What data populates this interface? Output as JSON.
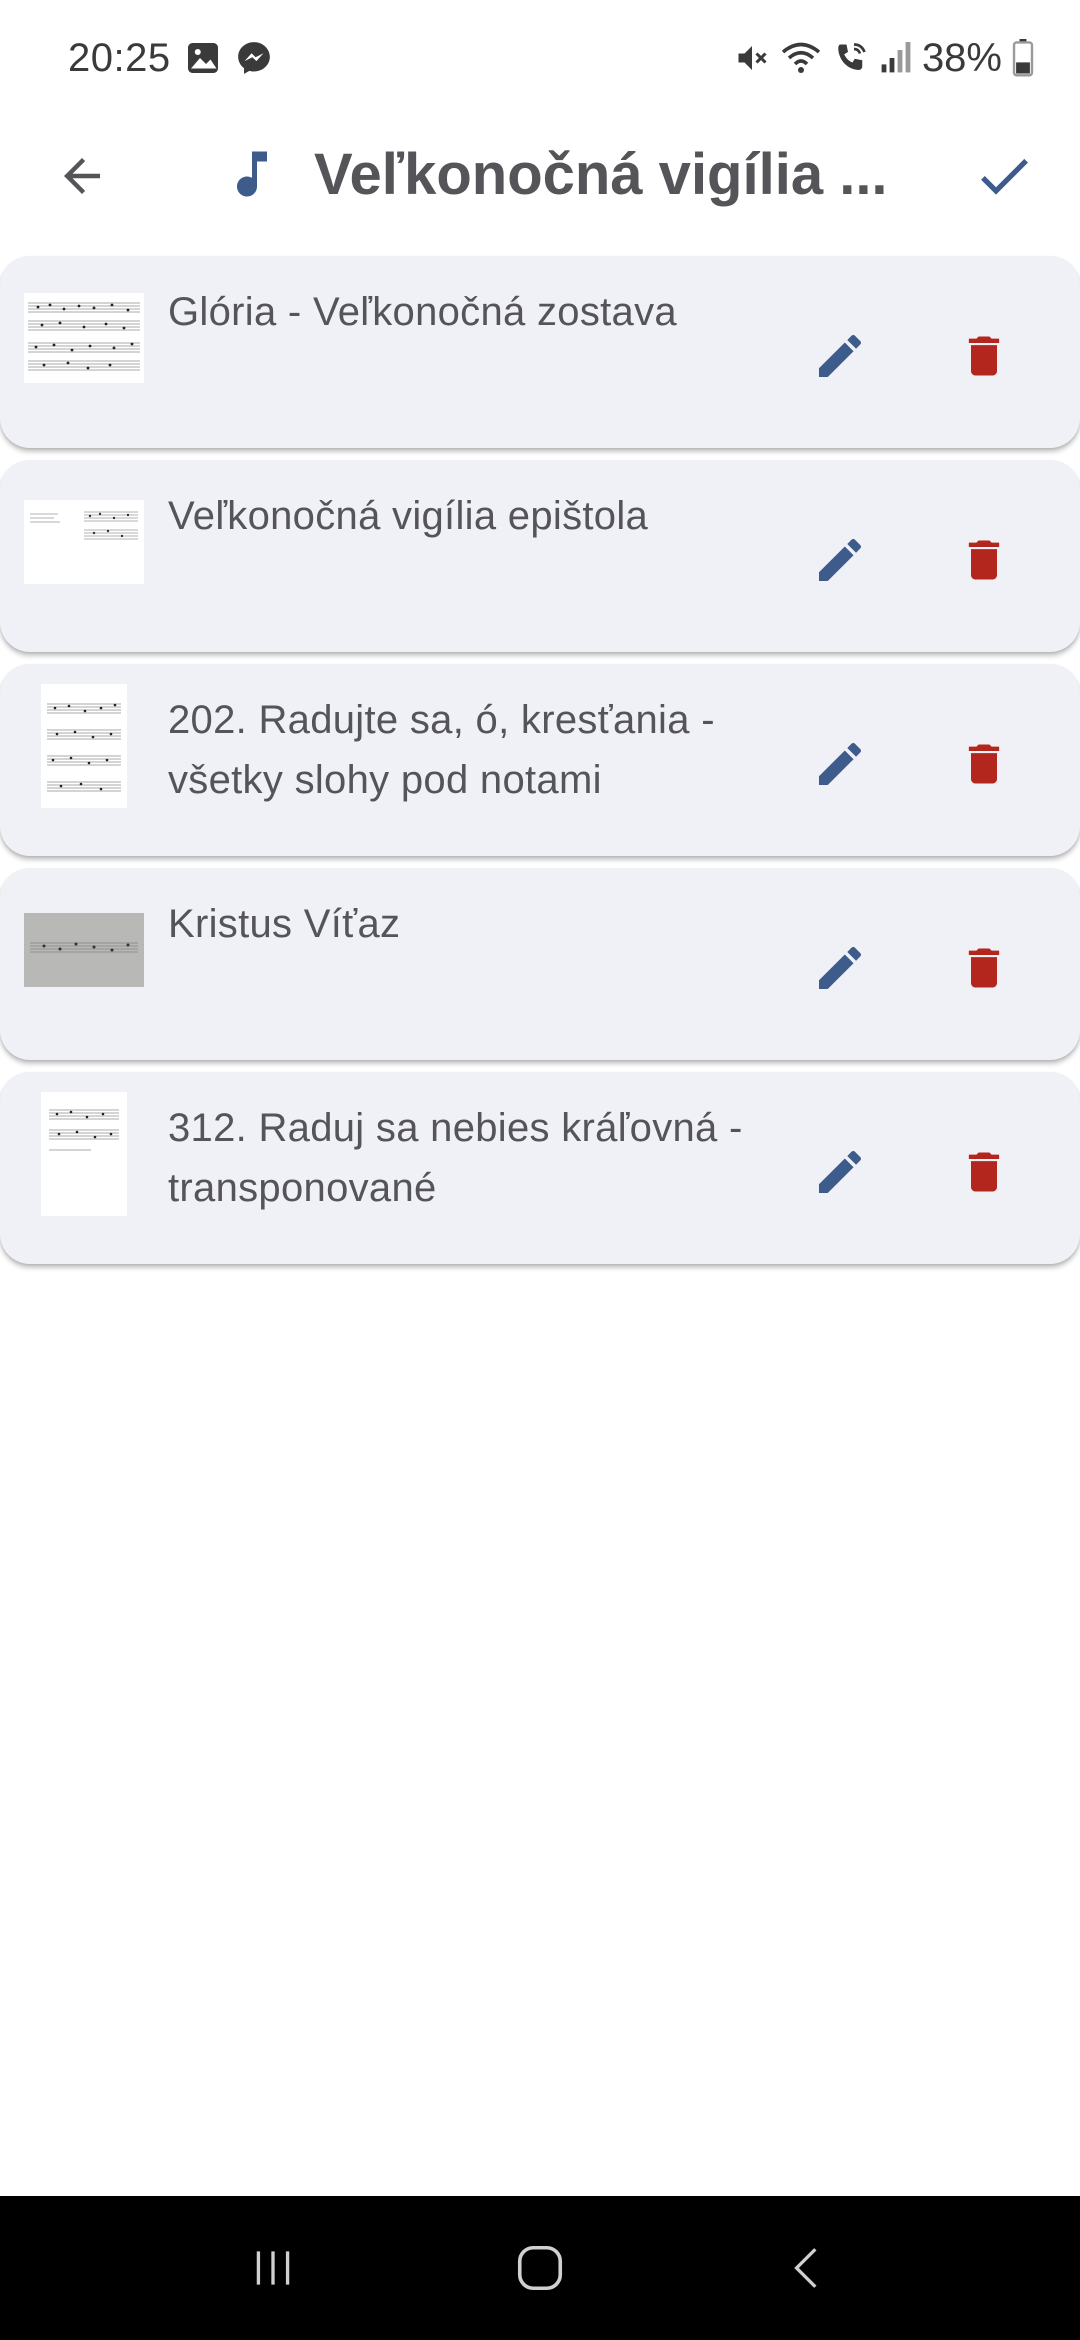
{
  "status_bar": {
    "time": "20:25",
    "notification_icons": [
      "gallery-icon",
      "messenger-icon"
    ],
    "system_icons": [
      "mute-icon",
      "wifi-icon",
      "wifi-call-icon",
      "signal-icon"
    ],
    "battery_text": "38%",
    "battery_level": 0.38
  },
  "app_bar": {
    "back_icon": "arrow-left-icon",
    "title_icon": "music-note-icon",
    "title": "Veľkonočná vigília ...",
    "confirm_icon": "check-icon"
  },
  "songs": [
    {
      "title": "Glória - Veľkonočná zostava",
      "thumbnail": "sheet-music-landscape"
    },
    {
      "title": "Veľkonočná vigília epištola",
      "thumbnail": "sheet-music-landscape-sparse"
    },
    {
      "title": "202. Radujte sa, ó, kresťania - všetky slohy pod notami",
      "thumbnail": "sheet-music-portrait"
    },
    {
      "title": "Kristus Víťaz",
      "thumbnail": "sheet-music-photo"
    },
    {
      "title": "312. Raduj sa nebies kráľovná - transponované",
      "thumbnail": "sheet-music-portrait-sparse"
    }
  ],
  "row_actions": {
    "edit_icon": "pencil-icon",
    "delete_icon": "trash-icon"
  },
  "colors": {
    "accent": "#3d5c8c",
    "delete": "#b3261e",
    "card_bg": "#f0f1f7",
    "text": "#555459"
  },
  "nav_bar": {
    "buttons": [
      "recent-apps-icon",
      "home-icon",
      "back-icon"
    ]
  }
}
